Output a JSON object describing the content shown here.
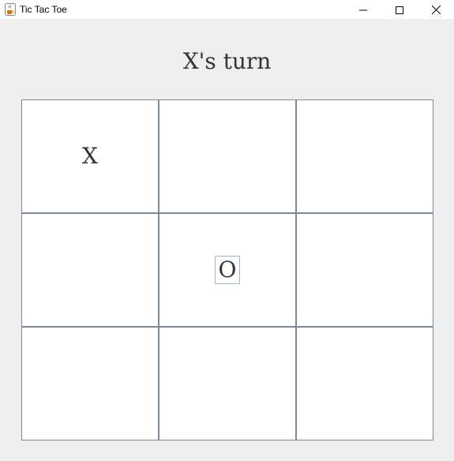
{
  "window": {
    "title": "Tic Tac Toe",
    "icon": "java-cup-icon",
    "controls": [
      "minimize-icon",
      "maximize-icon",
      "close-icon"
    ]
  },
  "status": {
    "text": "X's turn"
  },
  "board": {
    "cells": [
      "X",
      "",
      "",
      "",
      "O",
      "",
      "",
      "",
      ""
    ],
    "focused_cell": 4
  },
  "colors": {
    "background": "#eeeeee",
    "cell_background": "#ffffff",
    "cell_border": "#7a8a99",
    "text": "#333333"
  }
}
